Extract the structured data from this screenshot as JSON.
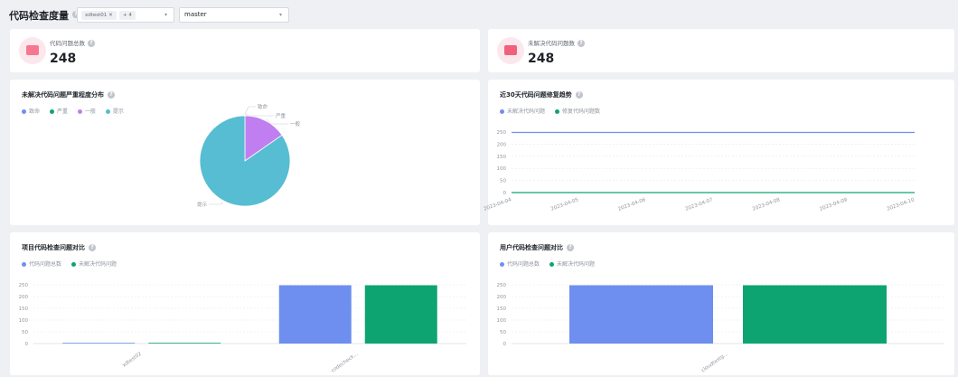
{
  "header": {
    "title": "代码检查度量",
    "repo_tag": "xdtest01",
    "more_tag": "+ 4",
    "branch": "master"
  },
  "stats": [
    {
      "label": "代码问题总数",
      "value": "248"
    },
    {
      "label": "未解决代码问题数",
      "value": "248"
    }
  ],
  "colors": {
    "fatal": "#6e8ff0",
    "serious": "#0ea472",
    "general": "#c07ef0",
    "hint": "#56bdd2"
  },
  "charts": {
    "pie": {
      "title": "未解决代码问题严重程度分布",
      "legend": [
        "致命",
        "严重",
        "一般",
        "提示"
      ]
    },
    "trend": {
      "title": "近30天代码问题修复趋势",
      "legend": [
        "未解决代码问题",
        "修复代码问题数"
      ]
    },
    "project": {
      "title": "项目代码检查问题对比",
      "legend": [
        "代码问题总数",
        "未解决代码问题"
      ]
    },
    "user": {
      "title": "用户代码检查问题对比",
      "legend": [
        "代码问题总数",
        "未解决代码问题"
      ]
    }
  },
  "chart_data": [
    {
      "type": "pie",
      "title": "未解决代码问题严重程度分布",
      "categories": [
        "致命",
        "严重",
        "一般",
        "提示"
      ],
      "values": [
        0,
        0,
        38,
        210
      ]
    },
    {
      "type": "line",
      "title": "近30天代码问题修复趋势",
      "x": [
        "2023-04-04",
        "2023-04-05",
        "2023-04-06",
        "2023-04-07",
        "2023-04-08",
        "2023-04-09",
        "2023-04-10"
      ],
      "series": [
        {
          "name": "未解决代码问题",
          "values": [
            248,
            248,
            248,
            248,
            248,
            248,
            248
          ]
        },
        {
          "name": "修复代码问题数",
          "values": [
            0,
            0,
            0,
            0,
            0,
            0,
            0
          ]
        }
      ],
      "yticks": [
        0,
        50,
        100,
        150,
        200,
        250
      ],
      "ylim": [
        0,
        250
      ]
    },
    {
      "type": "bar",
      "title": "项目代码检查问题对比",
      "categories": [
        "xdtest02",
        "codecheck..."
      ],
      "series": [
        {
          "name": "代码问题总数",
          "values": [
            0,
            248
          ]
        },
        {
          "name": "未解决代码问题",
          "values": [
            0,
            248
          ]
        }
      ],
      "yticks": [
        0,
        50,
        100,
        150,
        200,
        250
      ],
      "ylim": [
        0,
        250
      ]
    },
    {
      "type": "bar",
      "title": "用户代码检查问题对比",
      "categories": [
        "cloudtestg..."
      ],
      "series": [
        {
          "name": "代码问题总数",
          "values": [
            248
          ]
        },
        {
          "name": "未解决代码问题",
          "values": [
            248
          ]
        }
      ],
      "yticks": [
        0,
        50,
        100,
        150,
        200,
        250
      ],
      "ylim": [
        0,
        250
      ]
    }
  ]
}
